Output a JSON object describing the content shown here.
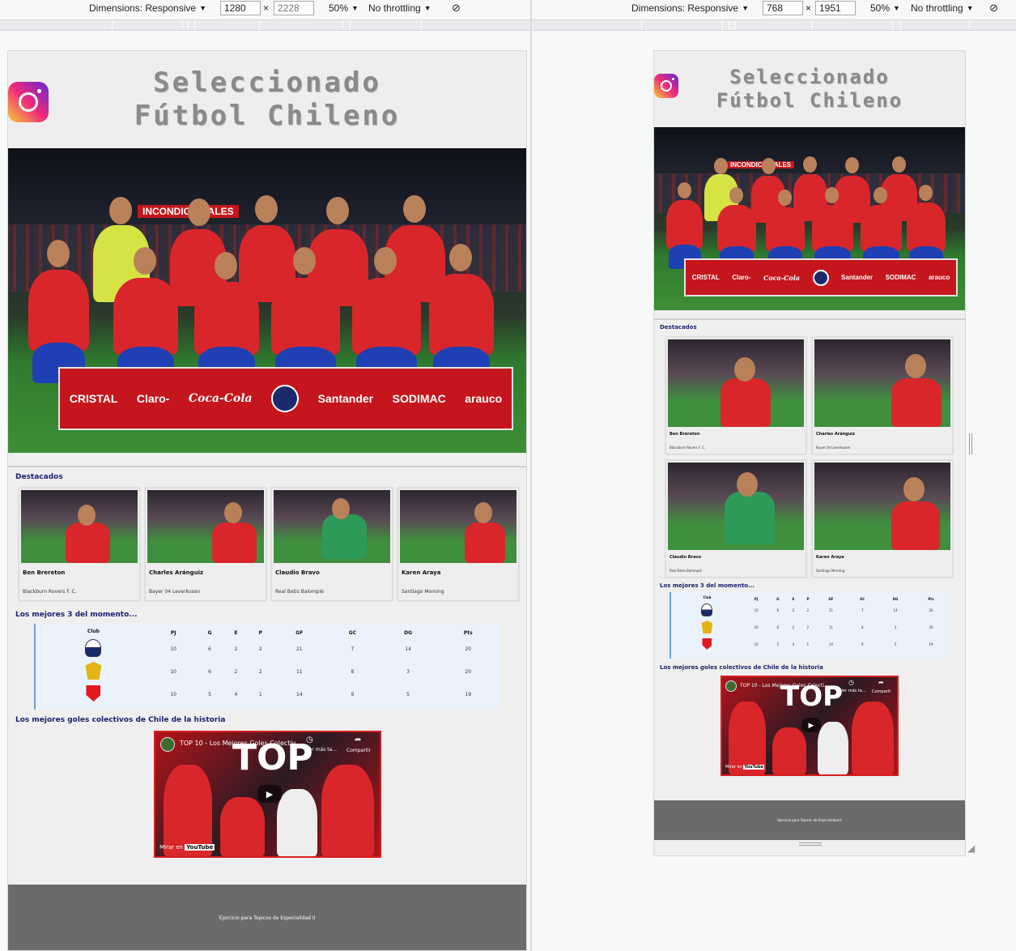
{
  "left_toolbar": {
    "dimensions_label": "Dimensions: Responsive",
    "width": "1280",
    "height_placeholder": "2228",
    "times": "×",
    "zoom": "50%",
    "throttle": "No throttling"
  },
  "right_toolbar": {
    "dimensions_label": "Dimensions: Responsive",
    "width": "768",
    "height": "1951",
    "times": "×",
    "zoom": "50%",
    "throttle": "No throttling"
  },
  "site": {
    "title_line1": "Seleccionado",
    "title_line2": "Fútbol Chileno",
    "banner_sponsors": [
      "CRISTAL",
      "Claro-",
      "Coca-Cola",
      "Santander",
      "SODIMAC",
      "arauco"
    ],
    "hero_banner_text": "INCONDICIONALES",
    "featured_title": "Destacados",
    "players": [
      {
        "name": "Ben Brereton",
        "club": "Blackburn Rovers F. C."
      },
      {
        "name": "Charles Aránguiz",
        "club": "Bayer 04 Leverkusen"
      },
      {
        "name": "Claudio Bravo",
        "club": "Real Betis Balompié"
      },
      {
        "name": "Karen Araya",
        "club": "Santiago Morning"
      }
    ],
    "table_title": "Los mejores 3 del momento...",
    "table_headers": [
      "Club",
      "PJ",
      "G",
      "E",
      "P",
      "GF",
      "GC",
      "DG",
      "Pts"
    ],
    "table_rows": [
      {
        "crest": "colo-colo-crest",
        "values": [
          "10",
          "6",
          "2",
          "2",
          "21",
          "7",
          "14",
          "20"
        ]
      },
      {
        "crest": "union-espanola-crest",
        "values": [
          "10",
          "6",
          "2",
          "2",
          "11",
          "8",
          "3",
          "20"
        ]
      },
      {
        "crest": "palestino-crest",
        "values": [
          "10",
          "5",
          "4",
          "1",
          "14",
          "9",
          "5",
          "19"
        ]
      }
    ],
    "video_section_title": "Los mejores goles colectivos de Chile de la historia",
    "video": {
      "title_left": "TOP 10 - Los Mejores Goles Colectiv...",
      "title_right": "TOP 10 - Los Mejores Goles Colecti...",
      "watch_later_left": "Ver más ta...",
      "watch_later_right": "Ver más ta...",
      "share": "Compartir",
      "share_short": "Comparti",
      "big_text": "TOP",
      "watch_on": "Mirar en",
      "youtube": "YouTube"
    },
    "footer_text": "Ejercicio para Topicos de Especialidad II"
  },
  "colors": {
    "title_gray": "#8a8a8a",
    "section_navy": "#1a1f6d",
    "footer_gray": "#6b6b6b",
    "chile_red": "#d9262b"
  }
}
